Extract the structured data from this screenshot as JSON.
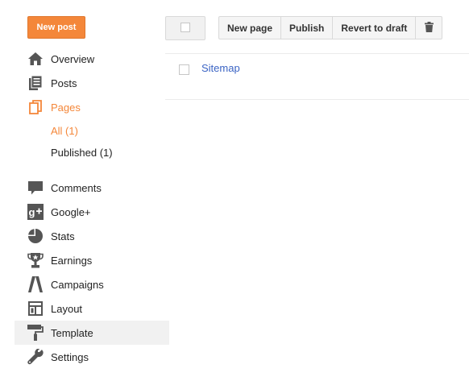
{
  "toolbar": {
    "new_post": "New post",
    "new_page": "New page",
    "publish": "Publish",
    "revert_to_draft": "Revert to draft",
    "trash_icon": "trash-icon"
  },
  "nav": {
    "items": [
      {
        "label": "Overview",
        "icon": "home-icon"
      },
      {
        "label": "Posts",
        "icon": "posts-icon"
      },
      {
        "label": "Pages",
        "icon": "pages-icon"
      },
      {
        "label": "Comments",
        "icon": "comment-icon"
      },
      {
        "label": "Google+",
        "icon": "google-plus-icon"
      },
      {
        "label": "Stats",
        "icon": "pie-chart-icon"
      },
      {
        "label": "Earnings",
        "icon": "trophy-icon"
      },
      {
        "label": "Campaigns",
        "icon": "adwords-icon"
      },
      {
        "label": "Layout",
        "icon": "layout-icon"
      },
      {
        "label": "Template",
        "icon": "paint-roller-icon"
      },
      {
        "label": "Settings",
        "icon": "wrench-icon"
      }
    ],
    "pages_sub": {
      "all": "All (1)",
      "published": "Published (1)"
    },
    "accent_color": "#f4873a"
  },
  "pages_list": [
    {
      "title": "Sitemap"
    }
  ]
}
